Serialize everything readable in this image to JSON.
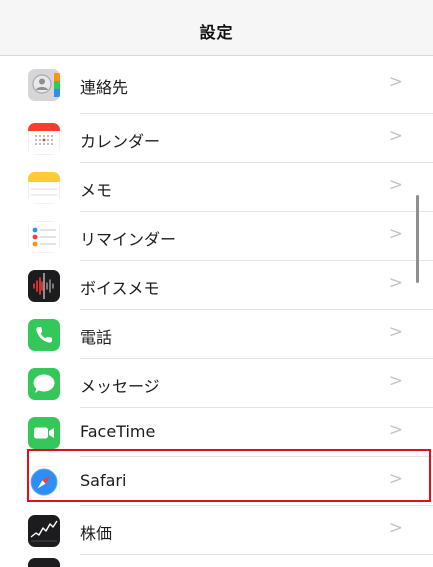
{
  "header": {
    "title": "設定"
  },
  "settings": {
    "items": [
      {
        "label": "連絡先",
        "icon": "contacts-icon"
      },
      {
        "label": "カレンダー",
        "icon": "calendar-icon"
      },
      {
        "label": "メモ",
        "icon": "notes-icon"
      },
      {
        "label": "リマインダー",
        "icon": "reminders-icon"
      },
      {
        "label": "ボイスメモ",
        "icon": "voice-memos-icon"
      },
      {
        "label": "電話",
        "icon": "phone-icon"
      },
      {
        "label": "メッセージ",
        "icon": "messages-icon"
      },
      {
        "label": "FaceTime",
        "icon": "facetime-icon"
      },
      {
        "label": "Safari",
        "icon": "safari-icon"
      },
      {
        "label": "株価",
        "icon": "stocks-icon"
      }
    ],
    "chevron": ">"
  },
  "highlight": {
    "target": "Safari",
    "color": "#e0101a"
  },
  "colors": {
    "phone": "#34c759",
    "messages": "#34c759",
    "facetime": "#34c759",
    "safari": "#2f8ef5",
    "calendar_red": "#ff3b30",
    "notes_yellow": "#ffcc33"
  }
}
